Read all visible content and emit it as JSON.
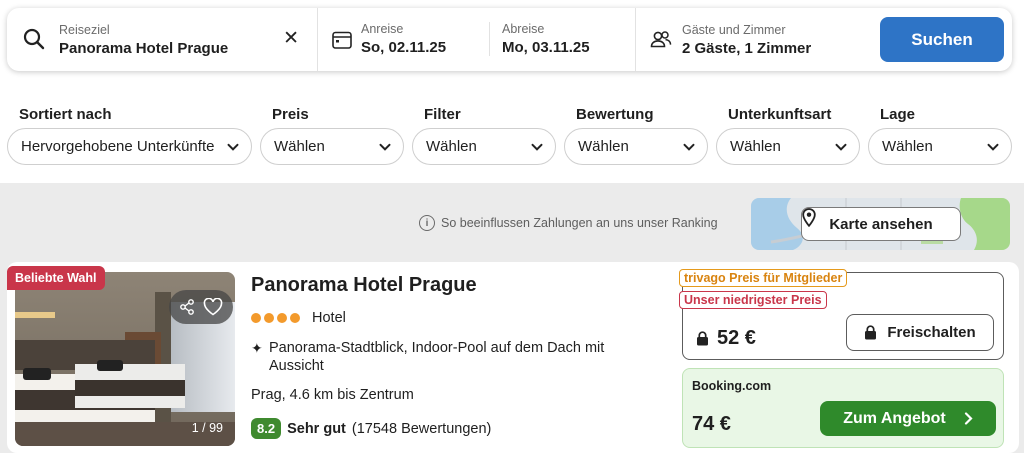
{
  "search": {
    "destination_label": "Reiseziel",
    "destination_value": "Panorama Hotel Prague",
    "clear_icon": "close-icon",
    "checkin_label": "Anreise",
    "checkin_value": "So, 02.11.25",
    "checkout_label": "Abreise",
    "checkout_value": "Mo, 03.11.25",
    "guests_label": "Gäste und Zimmer",
    "guests_value": "2 Gäste, 1 Zimmer",
    "search_button": "Suchen",
    "button_color": "#2e74c6"
  },
  "filters": [
    {
      "label": "Sortiert nach",
      "value": "Hervorgehobene Unterkünfte"
    },
    {
      "label": "Preis",
      "value": "Wählen"
    },
    {
      "label": "Filter",
      "value": "Wählen"
    },
    {
      "label": "Bewertung",
      "value": "Wählen"
    },
    {
      "label": "Unterkunftsart",
      "value": "Wählen"
    },
    {
      "label": "Lage",
      "value": "Wählen"
    }
  ],
  "ranking_info": "So beeinflussen Zahlungen an uns unser Ranking",
  "map": {
    "button_label": "Karte ansehen"
  },
  "hotel": {
    "badge": "Beliebte Wahl",
    "name": "Panorama Hotel Prague",
    "stars": 4,
    "type": "Hotel",
    "amenities": "Panorama-Stadtblick, Indoor-Pool auf dem Dach mit Aussicht",
    "location": "Prag, 4.6 km bis Zentrum",
    "rating_score": "8.2",
    "rating_label": "Sehr gut",
    "rating_count": "(17548 Bewertungen)",
    "photo_counter": "1 / 99",
    "member_tag": "trivago Preis für Mitglieder",
    "lowest_tag": "Unser niedrigster Preis",
    "member_price": "52 €",
    "unlock_button": "Freischalten",
    "partner": "Booking.com",
    "deal_price": "74 €",
    "deal_button": "Zum Angebot",
    "colors": {
      "badge": "#c9364a",
      "deal": "#2f8a2b",
      "stars": "#f39a2c",
      "member_tag": "#d98410"
    }
  }
}
